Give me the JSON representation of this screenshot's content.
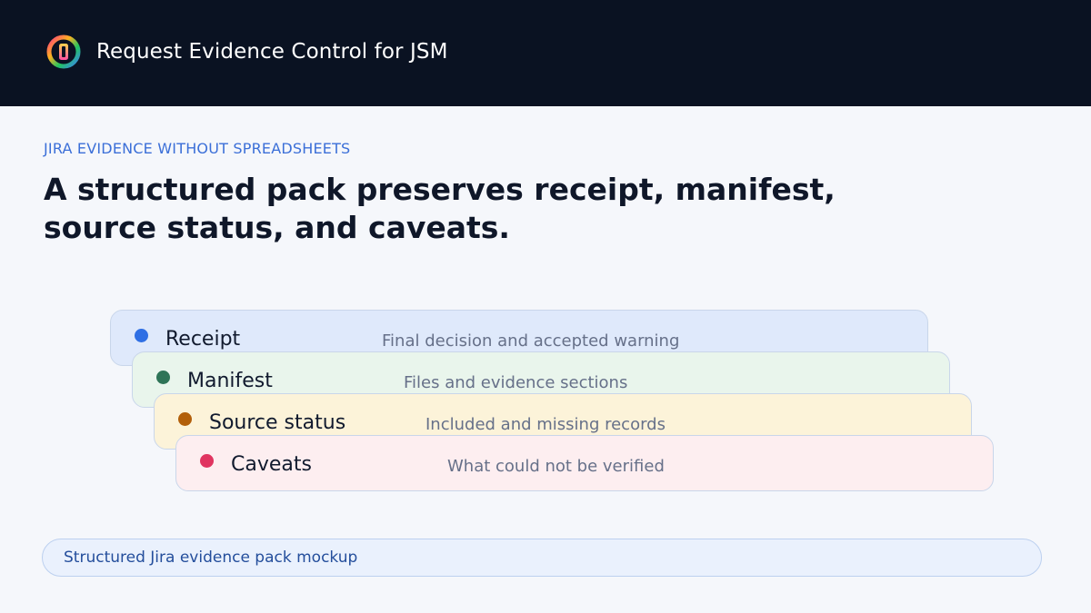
{
  "header": {
    "app_title": "Request Evidence Control for JSM",
    "logo_icon": "app-logo-icon"
  },
  "intro": {
    "eyebrow": "JIRA EVIDENCE WITHOUT SPREADSHEETS",
    "headline": "A structured pack preserves receipt, manifest, source status, and caveats."
  },
  "layers": [
    {
      "label": "Receipt",
      "description": "Final decision and accepted warning",
      "dot_color": "#2f6fe4"
    },
    {
      "label": "Manifest",
      "description": "Files and evidence sections",
      "dot_color": "#2e7457"
    },
    {
      "label": "Source status",
      "description": "Included and missing records",
      "dot_color": "#b25f0a"
    },
    {
      "label": "Caveats",
      "description": "What could not be verified",
      "dot_color": "#e03460"
    }
  ],
  "caption": {
    "text": "Structured Jira evidence pack mockup"
  }
}
